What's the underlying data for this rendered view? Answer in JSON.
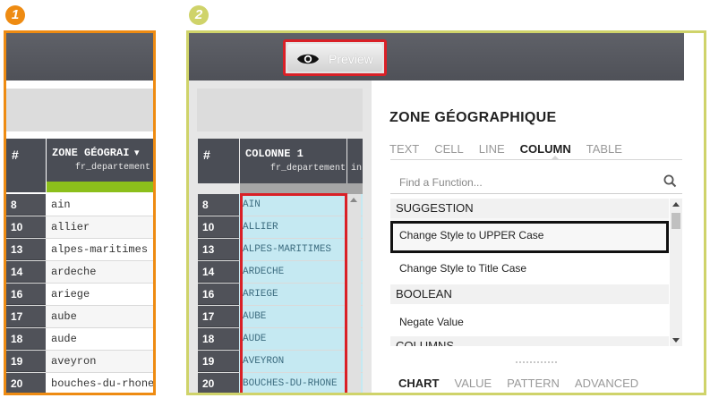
{
  "steps": {
    "one": "1",
    "two": "2"
  },
  "panel1": {
    "column": {
      "title": "ZONE GÉOGRAI",
      "subtitle": "fr_departement",
      "hash": "#",
      "sort_caret": "▾"
    },
    "rows": [
      {
        "num": "8",
        "value": "ain"
      },
      {
        "num": "10",
        "value": "allier"
      },
      {
        "num": "13",
        "value": "alpes-maritimes"
      },
      {
        "num": "14",
        "value": "ardeche"
      },
      {
        "num": "16",
        "value": "ariege"
      },
      {
        "num": "17",
        "value": "aube"
      },
      {
        "num": "18",
        "value": "aude"
      },
      {
        "num": "19",
        "value": "aveyron"
      },
      {
        "num": "20",
        "value": "bouches-du-rhone"
      }
    ]
  },
  "panel2": {
    "preview_label": "Preview",
    "column": {
      "title": "COLONNE 1",
      "subtitle": "fr_departement",
      "hash": "#",
      "next_col_peek": "in"
    },
    "rows": [
      {
        "num": "8",
        "value": "AIN"
      },
      {
        "num": "10",
        "value": "ALLIER"
      },
      {
        "num": "13",
        "value": "ALPES-MARITIMES"
      },
      {
        "num": "14",
        "value": "ARDECHE"
      },
      {
        "num": "16",
        "value": "ARIEGE"
      },
      {
        "num": "17",
        "value": "AUBE"
      },
      {
        "num": "18",
        "value": "AUDE"
      },
      {
        "num": "19",
        "value": "AVEYRON"
      },
      {
        "num": "20",
        "value": "BOUCHES-DU-RHONE"
      }
    ],
    "side": {
      "heading": "ZONE GÉOGRAPHIQUE",
      "tabs": [
        "TEXT",
        "CELL",
        "LINE",
        "COLUMN",
        "TABLE"
      ],
      "active_tab": 3,
      "search_placeholder": "Find a Function...",
      "sections": {
        "suggestion": "SUGGESTION",
        "boolean": "BOOLEAN",
        "columns": "COLUMNS"
      },
      "items": {
        "upper": "Change Style to UPPER Case",
        "title": "Change Style to Title Case",
        "negate": "Negate Value"
      },
      "bottom_tabs": [
        "CHART",
        "VALUE",
        "PATTERN",
        "ADVANCED"
      ],
      "bottom_active": 0
    }
  },
  "colors": {
    "orange": "#ee8b12",
    "green": "#cfd36a",
    "red": "#d92027",
    "cyan": "#c5e9f2",
    "lime": "#8cbf1b"
  }
}
